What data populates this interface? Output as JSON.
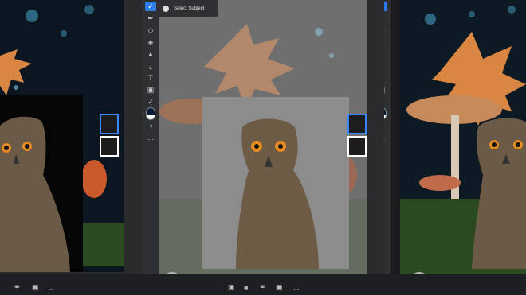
{
  "popup": {
    "select_subject": "Select Subject"
  },
  "icons": [
    "move-icon",
    "brush-icon",
    "eraser-icon",
    "fill-icon",
    "stamp-icon",
    "crop-icon",
    "type-icon",
    "image-icon",
    "eyedropper-icon",
    "color-swatch-icon",
    "adjust-icon",
    "more-icon"
  ],
  "bottom_more": "..."
}
